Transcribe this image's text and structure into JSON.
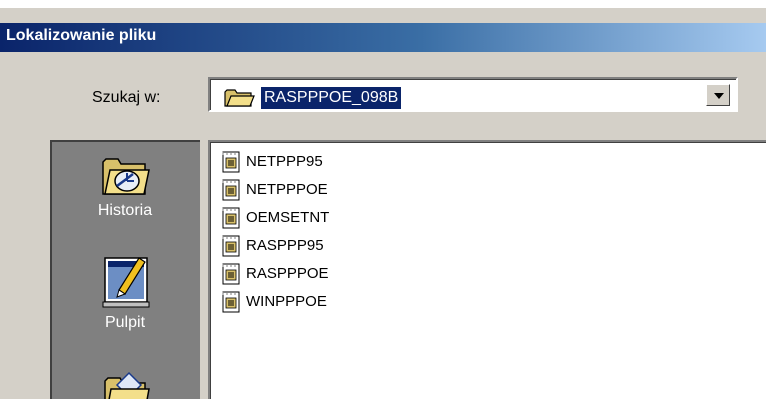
{
  "dialog": {
    "title": "Lokalizowanie pliku"
  },
  "look_in": {
    "label": "Szukaj w:",
    "value": "RASPPPOE_098B",
    "icon": "folder-icon"
  },
  "places": [
    {
      "label": "Historia",
      "icon": "history-icon"
    },
    {
      "label": "Pulpit",
      "icon": "desktop-icon"
    },
    {
      "label": "",
      "icon": "my-documents-icon"
    }
  ],
  "files": [
    {
      "name": "NETPPP95",
      "icon": "inf-file-icon"
    },
    {
      "name": "NETPPPOE",
      "icon": "inf-file-icon"
    },
    {
      "name": "OEMSETNT",
      "icon": "inf-file-icon"
    },
    {
      "name": "RASPPP95",
      "icon": "inf-file-icon"
    },
    {
      "name": "RASPPPOE",
      "icon": "inf-file-icon"
    },
    {
      "name": "WINPPPOE",
      "icon": "inf-file-icon"
    }
  ],
  "colors": {
    "titlebar_start": "#0a246a",
    "titlebar_end": "#a6caf0",
    "dialog_face": "#d4d0c8",
    "places_bar": "#808080",
    "selection": "#0a246a"
  }
}
